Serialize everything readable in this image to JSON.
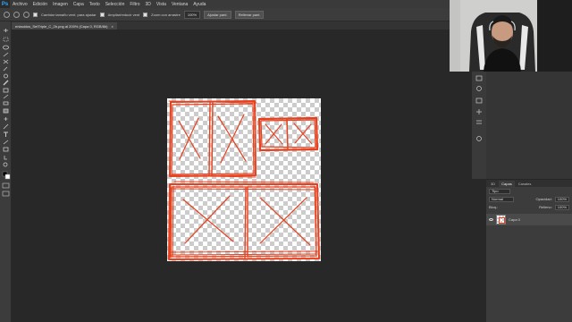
{
  "menubar": {
    "logo": "Ps",
    "items": [
      "Archivo",
      "Edición",
      "Imagen",
      "Capa",
      "Texto",
      "Selección",
      "Filtro",
      "3D",
      "Vista",
      "Ventana",
      "Ayuda"
    ]
  },
  "optionsbar": {
    "resize_windows": "Cambiar tamaño vent. para ajustar",
    "zoom_all_windows": "Ampliar/reducir vent",
    "scrubby_zoom": "Zoom con arrastre",
    "zoom_value": "100%",
    "fit_screen": "Ajustar pant.",
    "fill_screen": "Rellenar pant."
  },
  "document": {
    "tab_title": "enlaoidos_SetTriple_C_2b.png al 200% (Capa 0, RGB/8#)",
    "close": "×"
  },
  "layers_panel": {
    "tabs": [
      "3D",
      "Capas",
      "Canales"
    ],
    "filter_label": "Tipo",
    "blend_mode": "Normal",
    "opacity_label": "Opacidad:",
    "opacity_value": "100%",
    "lock_label": "Bloq.:",
    "fill_label": "Relleno:",
    "fill_value": "100%",
    "layer_name": "Capa 0"
  },
  "colors": {
    "accent_red": "#e8401c",
    "workspace": "#282828",
    "panel": "#3c3c3c",
    "ps_blue": "#31a8ff"
  },
  "icons": [
    "move-tool-icon",
    "marquee-tool-icon",
    "lasso-tool-icon",
    "brush-tool-icon",
    "eraser-tool-icon",
    "text-tool-icon",
    "zoom-tool-icon",
    "hand-tool-icon",
    "eye-icon"
  ]
}
